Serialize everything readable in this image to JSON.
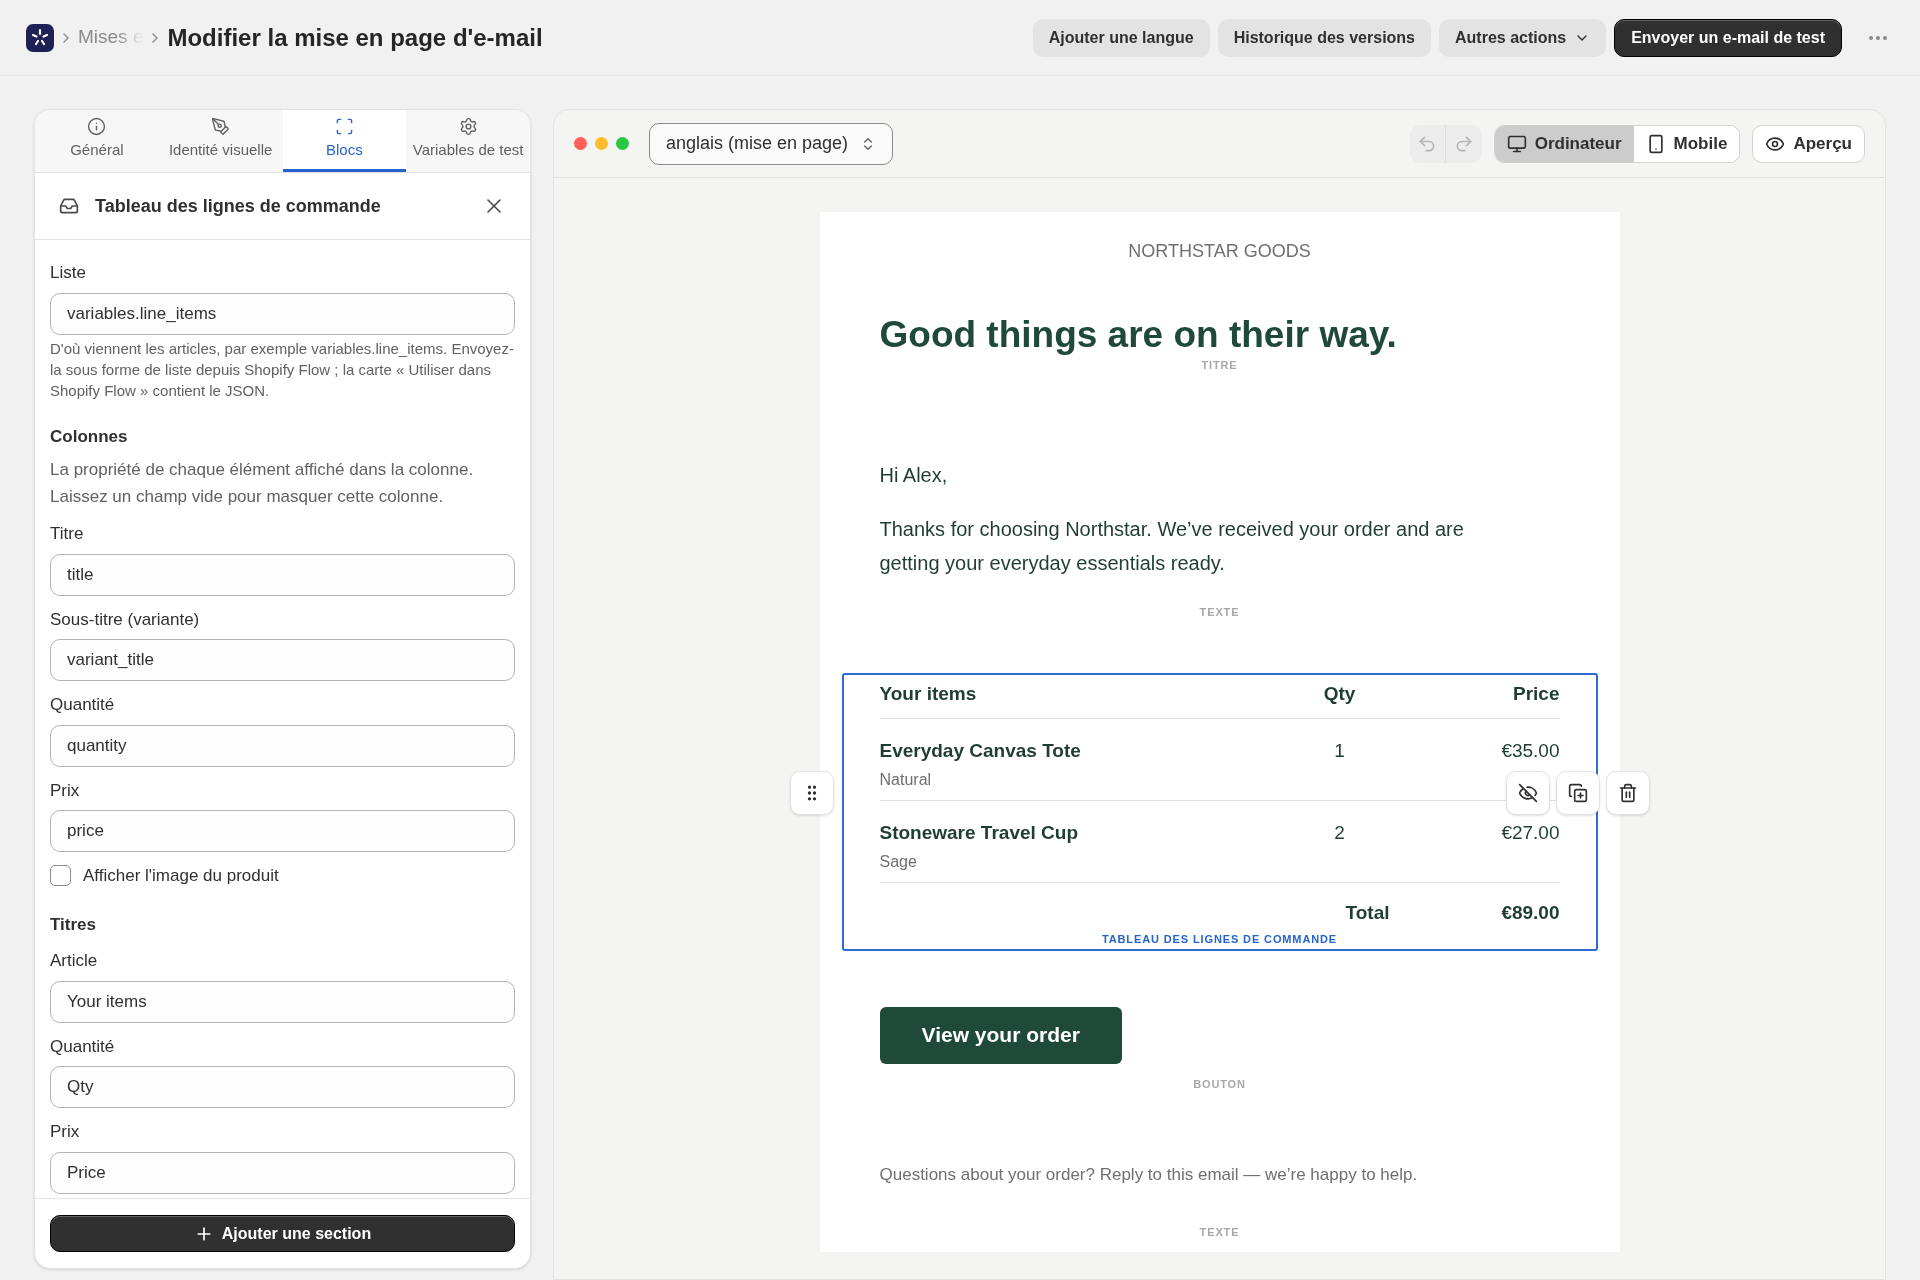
{
  "top_bar": {
    "breadcrumb": "Mises e",
    "title": "Modifier la mise en page d'e-mail",
    "actions": [
      {
        "label": "Ajouter une langue",
        "kind": "secondary"
      },
      {
        "label": "Historique des versions",
        "kind": "secondary"
      },
      {
        "label": "Autres actions",
        "kind": "dropdown"
      },
      {
        "label": "Envoyer un e-mail de test",
        "kind": "primary"
      }
    ]
  },
  "sidebar": {
    "tabs": [
      {
        "label": "Général",
        "selected": false
      },
      {
        "label": "Identité visuelle",
        "selected": false
      },
      {
        "label": "Blocs",
        "selected": true
      },
      {
        "label": "Variables de test",
        "selected": false
      }
    ],
    "panel_title": "Tableau des lignes de commande",
    "items": [
      {
        "kind": "field",
        "label": "Liste",
        "value": "variables.line_items"
      },
      {
        "kind": "help",
        "text": "D'où viennent les articles, par exemple variables.line_items. Envoyez-la sous forme de liste depuis Shopify Flow ; la carte « Utiliser dans Shopify Flow » contient le JSON."
      },
      {
        "kind": "heading",
        "text": "Colonnes"
      },
      {
        "kind": "description",
        "text": "La propriété de chaque élément affiché dans la colonne. Laissez un champ vide pour masquer cette colonne."
      },
      {
        "kind": "field",
        "label": "Titre",
        "value": "title"
      },
      {
        "kind": "field",
        "label": "Sous-titre (variante)",
        "value": "variant_title"
      },
      {
        "kind": "field",
        "label": "Quantité",
        "value": "quantity"
      },
      {
        "kind": "field",
        "label": "Prix",
        "value": "price"
      },
      {
        "kind": "checkbox",
        "label": "Afficher l'image du produit",
        "checked": false
      },
      {
        "kind": "heading",
        "text": "Titres"
      },
      {
        "kind": "field",
        "label": "Article",
        "value": "Your items"
      },
      {
        "kind": "field",
        "label": "Quantité",
        "value": "Qty"
      },
      {
        "kind": "field",
        "label": "Prix",
        "value": "Price"
      }
    ],
    "add_button": "Ajouter une section"
  },
  "preview": {
    "language": "anglais (mise en page)",
    "undo": {
      "disabled": true
    },
    "redo": {
      "disabled": true
    },
    "view_modes": [
      {
        "label": "Ordinateur",
        "selected": true
      },
      {
        "label": "Mobile",
        "selected": false
      }
    ],
    "preview_button": "Aperçu",
    "email": {
      "brand": "NORTHSTAR GOODS",
      "blocks": [
        {
          "kind": "heading",
          "text": "Good things are on their way.",
          "tag": "TITRE",
          "selected": false
        },
        {
          "kind": "text",
          "paragraphs": [
            "Hi Alex,",
            "Thanks for choosing Northstar. We’ve received your order and are getting your everyday essentials ready."
          ],
          "tag": "TEXTE",
          "selected": false
        },
        {
          "kind": "table",
          "tag": "TABLEAU DES LIGNES DE COMMANDE",
          "selected": true,
          "columns": [
            "Your items",
            "Qty",
            "Price"
          ],
          "rows": [
            {
              "title": "Everyday Canvas Tote",
              "variant": "Natural",
              "qty": "1",
              "price": "€35.00"
            },
            {
              "title": "Stoneware Travel Cup",
              "variant": "Sage",
              "qty": "2",
              "price": "€27.00"
            }
          ],
          "total_label": "Total",
          "total": "€89.00"
        },
        {
          "kind": "button",
          "label": "View your order",
          "tag": "BOUTON",
          "selected": false
        },
        {
          "kind": "small_text",
          "text": "Questions about your order? Reply to this email — we’re happy to help.",
          "tag": "TEXTE",
          "selected": false
        }
      ]
    }
  }
}
